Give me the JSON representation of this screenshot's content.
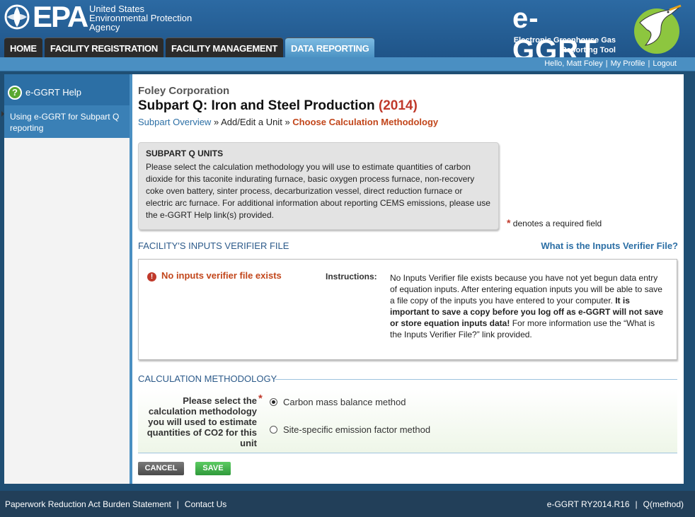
{
  "header": {
    "epa_word": "EPA",
    "epa_agency_lines": [
      "United States",
      "Environmental Protection",
      "Agency"
    ],
    "app_title": "e-GGRT",
    "app_subtitle_lines": [
      "Electronic Greenhouse Gas",
      "Reporting Tool"
    ]
  },
  "nav": {
    "tabs": [
      {
        "label": "HOME",
        "active": false
      },
      {
        "label": "FACILITY REGISTRATION",
        "active": false
      },
      {
        "label": "FACILITY MANAGEMENT",
        "active": false
      },
      {
        "label": "DATA REPORTING",
        "active": true
      }
    ]
  },
  "userbar": {
    "greeting": "Hello, Matt Foley",
    "my_profile": "My Profile",
    "logout": "Logout"
  },
  "sidebar": {
    "help_title": "e-GGRT Help",
    "help_link": "Using e-GGRT for Subpart Q reporting"
  },
  "main": {
    "company": "Foley Corporation",
    "title": "Subpart Q: Iron and Steel Production",
    "year": "(2014)",
    "breadcrumb": {
      "overview": "Subpart Overview",
      "sep": "»",
      "add_edit": "Add/Edit a Unit",
      "current": "Choose Calculation Methodology"
    },
    "units_box": {
      "heading": "SUBPART Q UNITS",
      "text": "Please select the calculation methodology you will use to estimate quantities of carbon dioxide for this taconite indurating furnace, basic oxygen process furnace, non-recovery coke oven battery, sinter process, decarburization vessel, direct reduction furnace or electric arc furnace. For additional information about reporting CEMS emissions, please use the e-GGRT Help link(s) provided."
    },
    "required_note": {
      "star": "*",
      "text": "denotes a required field"
    },
    "verifier": {
      "heading": "FACILITY'S INPUTS VERIFIER FILE",
      "link": "What is the Inputs Verifier File?",
      "status": "No inputs verifier file exists",
      "instructions_label": "Instructions:",
      "instructions_part1": "No Inputs Verifier file exists because you have not yet begun data entry of equation inputs.  After entering equation inputs you will be able to save a file copy of the inputs you have entered to your computer.",
      "instructions_bold": "It is important to save a copy before you log off as e-GGRT will not save or store equation inputs data!",
      "instructions_part2": "For more information use the “What is the Inputs Verifier File?” link provided."
    },
    "calc": {
      "legend": "CALCULATION METHODOLOGY",
      "question": "Please select the calculation methodology you will used to estimate quantities of CO2 for this unit",
      "required_star": "*",
      "options": [
        {
          "label": "Carbon mass balance method",
          "checked": true
        },
        {
          "label": "Site-specific emission factor method",
          "checked": false
        }
      ]
    },
    "buttons": {
      "cancel": "CANCEL",
      "save": "SAVE"
    }
  },
  "footer": {
    "paperwork": "Paperwork Reduction Act Burden Statement",
    "contact": "Contact Us",
    "version": "e-GGRT RY2014.R16",
    "page_code": "Q(method)"
  }
}
